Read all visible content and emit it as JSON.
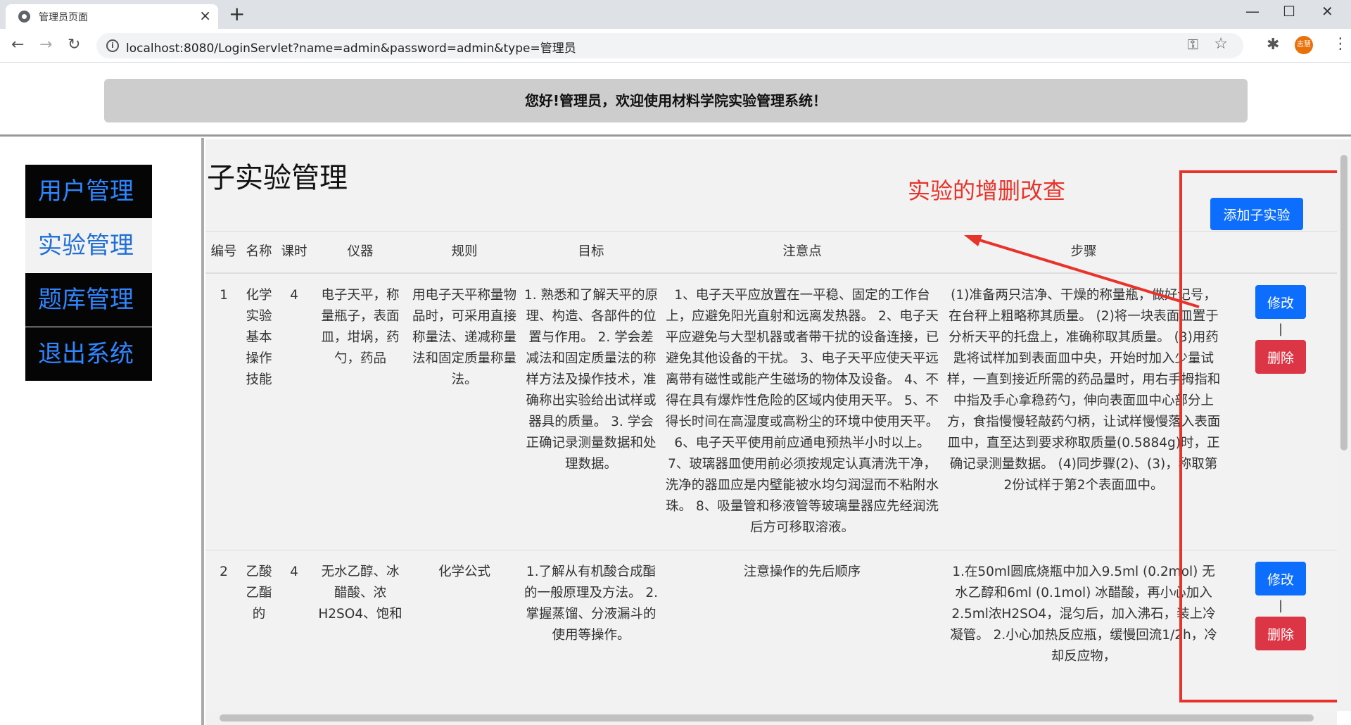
{
  "browser": {
    "tab_title": "管理员页面",
    "tab_close": "×",
    "new_tab": "+",
    "url": "localhost:8080/LoginServlet?name=admin&password=admin&type=管理员",
    "profile_label": "志慧",
    "window_controls": [
      "—",
      "☐",
      "✕"
    ]
  },
  "header": {
    "welcome": "您好!管理员，欢迎使用材料学院实验管理系统！"
  },
  "sidebar": {
    "items": [
      {
        "label": "用户管理"
      },
      {
        "label": "实验管理"
      },
      {
        "label": "题库管理"
      },
      {
        "label": "退出系统"
      }
    ],
    "active_index": 1
  },
  "content": {
    "title": "子实验管理",
    "annotation": "实验的增删改查",
    "add_button": "添加子实验",
    "edit_button": "修改",
    "delete_button": "删除",
    "separator": "|"
  },
  "table": {
    "columns": [
      "编号",
      "名称",
      "课时",
      "仪器",
      "规则",
      "目标",
      "注意点",
      "步骤",
      ""
    ],
    "rows": [
      {
        "id": "1",
        "name": "化学实验基本操作技能",
        "hours": "4",
        "equipment": "电子天平，称量瓶子，表面皿，坩埚，药勺，药品",
        "rules": "用电子天平称量物品时，可采用直接称量法、递减称量法和固定质量称量法。",
        "goals": "1. 熟悉和了解天平的原理、构造、各部件的位置与作用。 2. 学会差减法和固定质量法的称样方法及操作技术，准确称出实验给出试样或器具的质量。 3. 学会正确记录测量数据和处理数据。",
        "notes": "1、电子天平应放置在一平稳、固定的工作台上，应避免阳光直射和远离发热器。 2、电子天平应避免与大型机器或者带干扰的设备连接，已避免其他设备的干扰。 3、电子天平应使天平远离带有磁性或能产生磁场的物体及设备。 4、不得在具有爆炸性危险的区域内使用天平。 5、不得长时间在高湿度或高粉尘的环境中使用天平。 6、电子天平使用前应通电预热半小时以上。 7、玻璃器皿使用前必须按规定认真清洗干净，洗净的器皿应是内壁能被水均匀润湿而不粘附水珠。 8、吸量管和移液管等玻璃量器应先经润洗后方可移取溶液。",
        "steps": "(1)准备两只洁净、干燥的称量瓶，做好记号，在台秤上粗略称其质量。 (2)将一块表面皿置于分析天平的托盘上，准确称取其质量。 (3)用药匙将试样加到表面皿中央，开始时加入少量试样，一直到接近所需的药品量时，用右手拇指和中指及手心拿稳药勺，伸向表面皿中心部分上方，食指慢慢轻敲药勺柄，让试样慢慢落入表面皿中，直至达到要求称取质量(0.5884g)时，正确记录测量数据。 (4)同步骤(2)、(3)，称取第2份试样于第2个表面皿中。"
      },
      {
        "id": "2",
        "name": "乙酸乙酯的",
        "hours": "4",
        "equipment": "无水乙醇、冰醋酸、浓H2SO4、饱和",
        "rules": "化学公式",
        "goals": "1.了解从有机酸合成酯的一般原理及方法。 2. 掌握蒸馏、分液漏斗的使用等操作。",
        "notes": "注意操作的先后顺序",
        "steps": "1.在50ml圆底烧瓶中加入9.5ml (0.2mol) 无水乙醇和6ml (0.1mol) 冰醋酸，再小心加入2.5ml浓H2SO4，混匀后，加入沸石，装上冷凝管。 2.小心加热反应瓶，缓慢回流1/2h，冷却反应物，"
      }
    ]
  },
  "colors": {
    "primary": "#0d6efd",
    "danger": "#dc3545",
    "annotation": "#e8332a",
    "sidebar_bg": "#050505",
    "sidebar_text": "#2f86ff"
  }
}
